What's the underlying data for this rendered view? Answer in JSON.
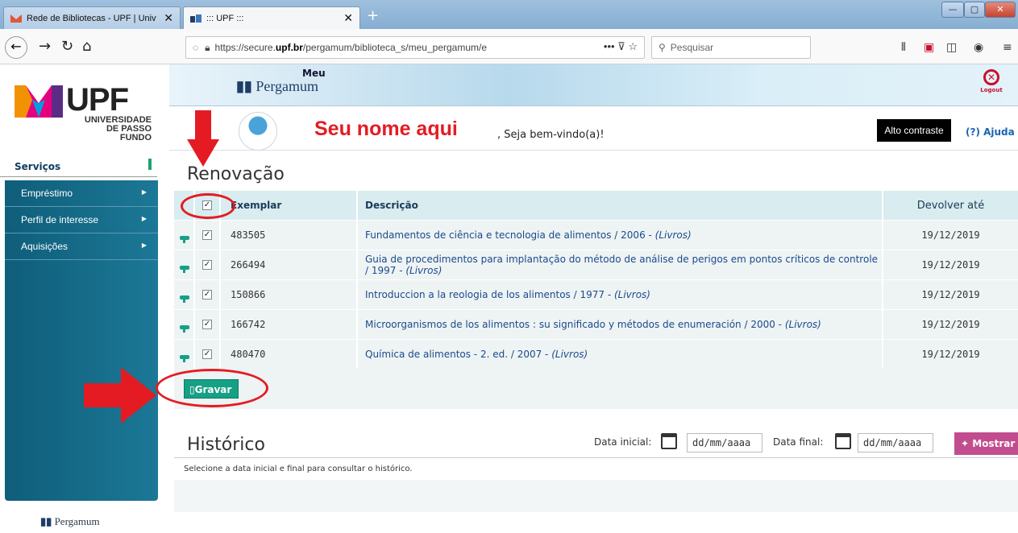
{
  "browser": {
    "tabs": [
      {
        "title": "Rede de Bibliotecas - UPF | Univ"
      },
      {
        "title": "::: UPF :::"
      }
    ],
    "url_prefix": "https://secure.",
    "url_domain": "upf.br",
    "url_rest": "/pergamum/biblioteca_s/meu_pergamum/e",
    "search_placeholder": "Pesquisar"
  },
  "brand": {
    "logo_text": "UPF",
    "logo_sub_line1": "UNIVERSIDADE",
    "logo_sub_line2": "DE PASSO FUNDO",
    "meu": "Meu",
    "pergamum": "Pergamum",
    "footer_pergamum": "Pergamum",
    "logout": "Logout"
  },
  "user": {
    "name": "Seu nome aqui",
    "welcome": ", Seja bem-vindo(a)!",
    "contrast": "Alto contraste",
    "help": "(?) Ajuda"
  },
  "sidebar": {
    "section": "Serviços",
    "items": [
      {
        "label": "Empréstimo"
      },
      {
        "label": "Perfil de interesse"
      },
      {
        "label": "Aquisições"
      }
    ]
  },
  "renovacao": {
    "title": "Renovação",
    "columns": {
      "exemplar": "Exemplar",
      "descricao": "Descrição",
      "devolver": "Devolver até"
    },
    "rows": [
      {
        "exemplar": "483505",
        "descricao": "Fundamentos de ciência e tecnologia de alimentos / 2006 - ",
        "tipo": "(Livros)",
        "devolver": "19/12/2019"
      },
      {
        "exemplar": "266494",
        "descricao": "Guia de procedimentos para implantação do método de análise de perigos em pontos críticos de controle / 1997 - ",
        "tipo": "(Livros)",
        "devolver": "19/12/2019"
      },
      {
        "exemplar": "150866",
        "descricao": "Introduccion a la reologia de los alimentos / 1977 - ",
        "tipo": "(Livros)",
        "devolver": "19/12/2019"
      },
      {
        "exemplar": "166742",
        "descricao": "Microorganismos de los alimentos : su significado y métodos de enumeración / 2000 - ",
        "tipo": "(Livros)",
        "devolver": "19/12/2019"
      },
      {
        "exemplar": "480470",
        "descricao": "Química de alimentos - 2. ed. / 2007 - ",
        "tipo": "(Livros)",
        "devolver": "19/12/2019"
      }
    ],
    "save_label": "Gravar"
  },
  "historico": {
    "title": "Histórico",
    "data_inicial_label": "Data inicial:",
    "data_final_label": "Data final:",
    "date_placeholder": "dd/mm/aaaa",
    "mostrar_label": "Mostrar",
    "message": "Selecione a data inicial e final para consultar o histórico."
  },
  "colors": {
    "accent_green": "#16a085",
    "sidebar_blue": "#0f5e7a",
    "annotation_red": "#e41b23",
    "mostrar_pink": "#c24d8e"
  }
}
